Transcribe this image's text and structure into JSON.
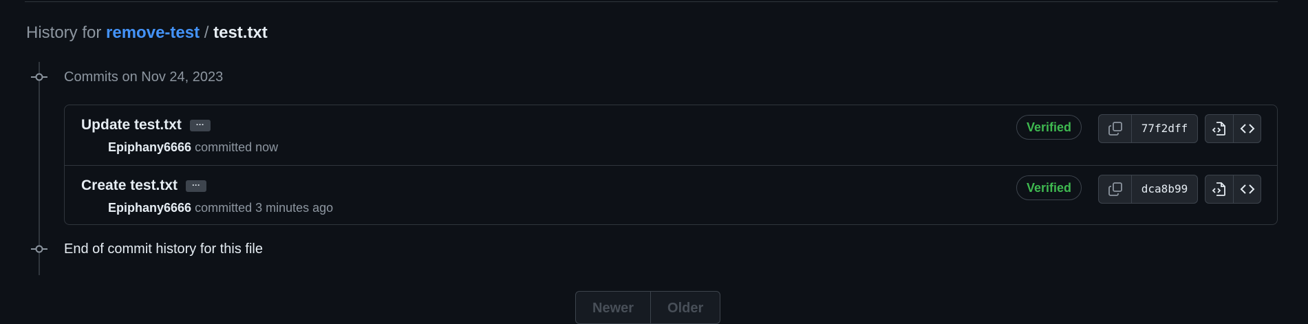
{
  "breadcrumb": {
    "prefix": "History for",
    "repo": "remove-test",
    "separator": "/",
    "file": "test.txt"
  },
  "timeline": {
    "group_title": "Commits on Nov 24, 2023",
    "end_text": "End of commit history for this file"
  },
  "commits": [
    {
      "title": "Update test.txt",
      "ellipsis": "···",
      "author": "Epiphany6666",
      "action_text": "committed now",
      "badge": "Verified",
      "sha": "77f2dff",
      "icons": [
        "copy-icon",
        "file-code-icon",
        "code-icon"
      ]
    },
    {
      "title": "Create test.txt",
      "ellipsis": "···",
      "author": "Epiphany6666",
      "action_text": "committed 3 minutes ago",
      "badge": "Verified",
      "sha": "dca8b99",
      "icons": [
        "copy-icon",
        "file-code-icon",
        "code-icon"
      ]
    }
  ],
  "pagination": {
    "newer_label": "Newer",
    "older_label": "Older"
  },
  "colors": {
    "background": "#0d1117",
    "link": "#4493f8",
    "verified": "#3fb950",
    "border": "#30363d",
    "muted": "#8d96a0"
  }
}
